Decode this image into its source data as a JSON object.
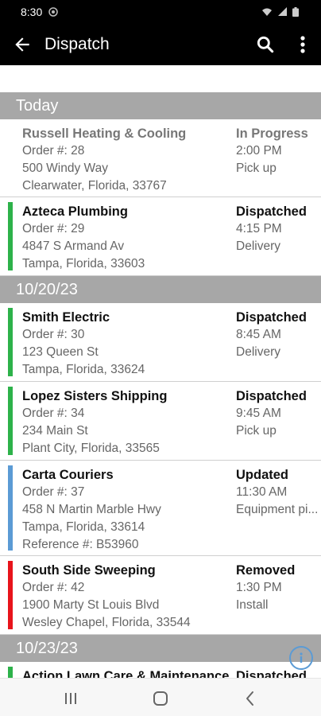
{
  "status_bar": {
    "time": "8:30"
  },
  "app_bar": {
    "title": "Dispatch"
  },
  "sections": [
    {
      "date": "Today",
      "items": [
        {
          "name": "Russell Heating & Cooling",
          "order": "Order #: 28",
          "address": "500 Windy Way",
          "city": "Clearwater, Florida, 33767",
          "status": "In Progress",
          "time": "2:00 PM",
          "type": "Pick up",
          "bar_color": "",
          "muted": true
        },
        {
          "name": "Azteca Plumbing",
          "order": "Order #: 29",
          "address": "4847 S Armand Av",
          "city": "Tampa, Florida, 33603",
          "status": "Dispatched",
          "time": "4:15 PM",
          "type": "Delivery",
          "bar_color": "#2db24a",
          "muted": false
        }
      ]
    },
    {
      "date": "10/20/23",
      "items": [
        {
          "name": "Smith Electric",
          "order": "Order #: 30",
          "address": "123 Queen St",
          "city": "Tampa, Florida, 33624",
          "status": "Dispatched",
          "time": "8:45 AM",
          "type": "Delivery",
          "bar_color": "#2db24a",
          "muted": false
        },
        {
          "name": "Lopez Sisters Shipping",
          "order": "Order #: 34",
          "address": "234 Main St",
          "city": "Plant City, Florida, 33565",
          "status": "Dispatched",
          "time": "9:45 AM",
          "type": "Pick up",
          "bar_color": "#2db24a",
          "muted": false
        },
        {
          "name": "Carta Couriers",
          "order": "Order #: 37",
          "address": "458 N Martin Marble Hwy",
          "city": "Tampa, Florida, 33614",
          "reference": "Reference #: B53960",
          "status": "Updated",
          "time": "11:30 AM",
          "type": "Equipment pi...",
          "bar_color": "#5b9bd5",
          "muted": false
        },
        {
          "name": "South Side Sweeping",
          "order": "Order #: 42",
          "address": "1900 Marty St Louis Blvd",
          "city": "Wesley Chapel, Florida, 33544",
          "status": "Removed",
          "time": "1:30 PM",
          "type": "Install",
          "bar_color": "#e8141b",
          "muted": false
        }
      ]
    },
    {
      "date": "10/23/23",
      "items": [
        {
          "name": "Action Lawn Care & Maintenance",
          "order": "",
          "address": "",
          "city": "",
          "status": "Dispatched",
          "time": "",
          "type": "",
          "bar_color": "#2db24a",
          "muted": false
        }
      ]
    }
  ],
  "icons": {
    "back": "arrow-left-icon",
    "search": "search-icon",
    "more": "more-vertical-icon",
    "info": "info-icon",
    "nav_recents": "recents-icon",
    "nav_home": "home-icon",
    "nav_back": "back-chevron-icon"
  }
}
